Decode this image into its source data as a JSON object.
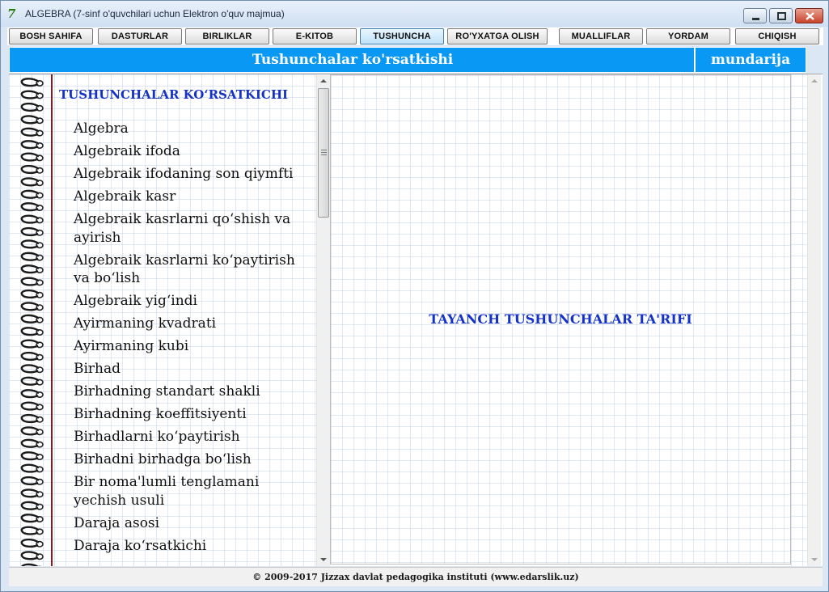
{
  "window": {
    "title": "ALGEBRA (7-sinf o'quvchilari uchun Elektron o'quv majmua)",
    "icon": "app-logo-icon"
  },
  "nav": {
    "items": [
      {
        "label": "BOSH SAHIFA",
        "active": false
      },
      {
        "label": "DASTURLAR",
        "active": false
      },
      {
        "label": "BIRLIKLAR",
        "active": false
      },
      {
        "label": "E-KITOB",
        "active": false
      },
      {
        "label": "TUSHUNCHA",
        "active": true
      },
      {
        "label": "RO'YXATGA OLISH",
        "active": false
      },
      {
        "label": "MUALLIFLAR",
        "active": false
      },
      {
        "label": "YORDAM",
        "active": false
      },
      {
        "label": "CHIQISH",
        "active": false
      }
    ]
  },
  "header": {
    "title": "Tushunchalar ko'rsatkishi",
    "link": "mundarija"
  },
  "left_pane": {
    "heading": "TUSHUNCHALAR KO‘RSATKICHI",
    "terms": [
      "Algebra",
      "Algebraik ifoda",
      "Algebraik ifodaning son qiymfti",
      "Algebraik kasr",
      "Algebraik kasrlarni qo‘shish va ayirish",
      "Algebraik kasrlarni ko‘paytirish va bo‘lish",
      "Algebraik yig‘indi",
      "Ayirmaning kvadrati",
      "Ayirmaning kubi",
      "Birhad",
      "Birhadning standart shakli",
      "Birhadning koeffitsiyenti",
      "Birhadlarni ko‘paytirish",
      "Birhadni birhadga bo‘lish",
      "Bir noma'lumli tenglamani yechish usuli",
      "Daraja asosi",
      "Daraja ko‘rsatkichi"
    ]
  },
  "right_pane": {
    "text": "TAYANCH TUSHUNCHALAR TA'RIFI"
  },
  "footer": {
    "text": "© 2009-2017 Jizzax davlat pedagogika instituti   (www.edarslik.uz)"
  },
  "colors": {
    "header_blue": "#0a98f5",
    "heading_blue": "#1432c8",
    "margin_red": "#8b1a1a"
  }
}
